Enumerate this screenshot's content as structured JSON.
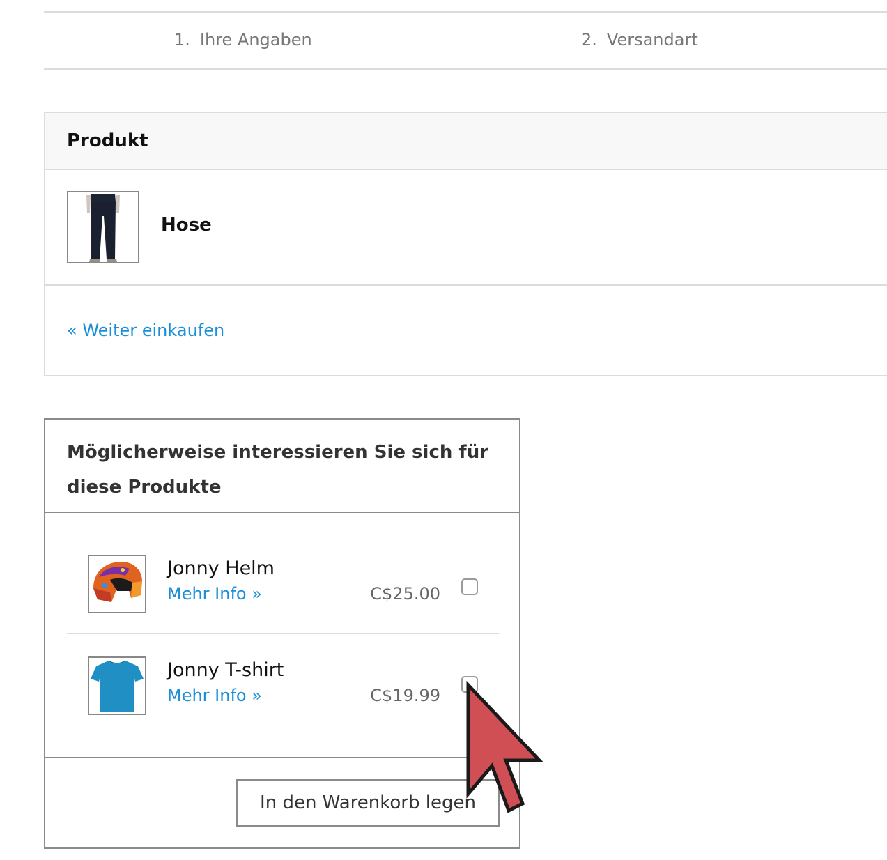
{
  "steps": [
    {
      "num": "1.",
      "label": "Ihre Angaben"
    },
    {
      "num": "2.",
      "label": "Versandart"
    }
  ],
  "cart": {
    "header": "Produkt",
    "items": [
      {
        "name": "Hose",
        "image_icon": "jeans-image"
      }
    ],
    "continue_link": "« Weiter einkaufen"
  },
  "crosssell": {
    "title": "Möglicherweise interessieren Sie sich für diese Produkte",
    "items": [
      {
        "name": "Jonny Helm",
        "more": "Mehr Info »",
        "price": "C$25.00",
        "checked": false,
        "image_icon": "helmet-image"
      },
      {
        "name": "Jonny T-shirt",
        "more": "Mehr Info »",
        "price": "C$19.99",
        "checked": false,
        "image_icon": "tshirt-image"
      }
    ],
    "add_button": "In den Warenkorb legen"
  },
  "colors": {
    "link": "#1a8fd8",
    "border_light": "#dcdcdc",
    "border_dark": "#8a8a8a",
    "cursor": "#d04f55"
  }
}
